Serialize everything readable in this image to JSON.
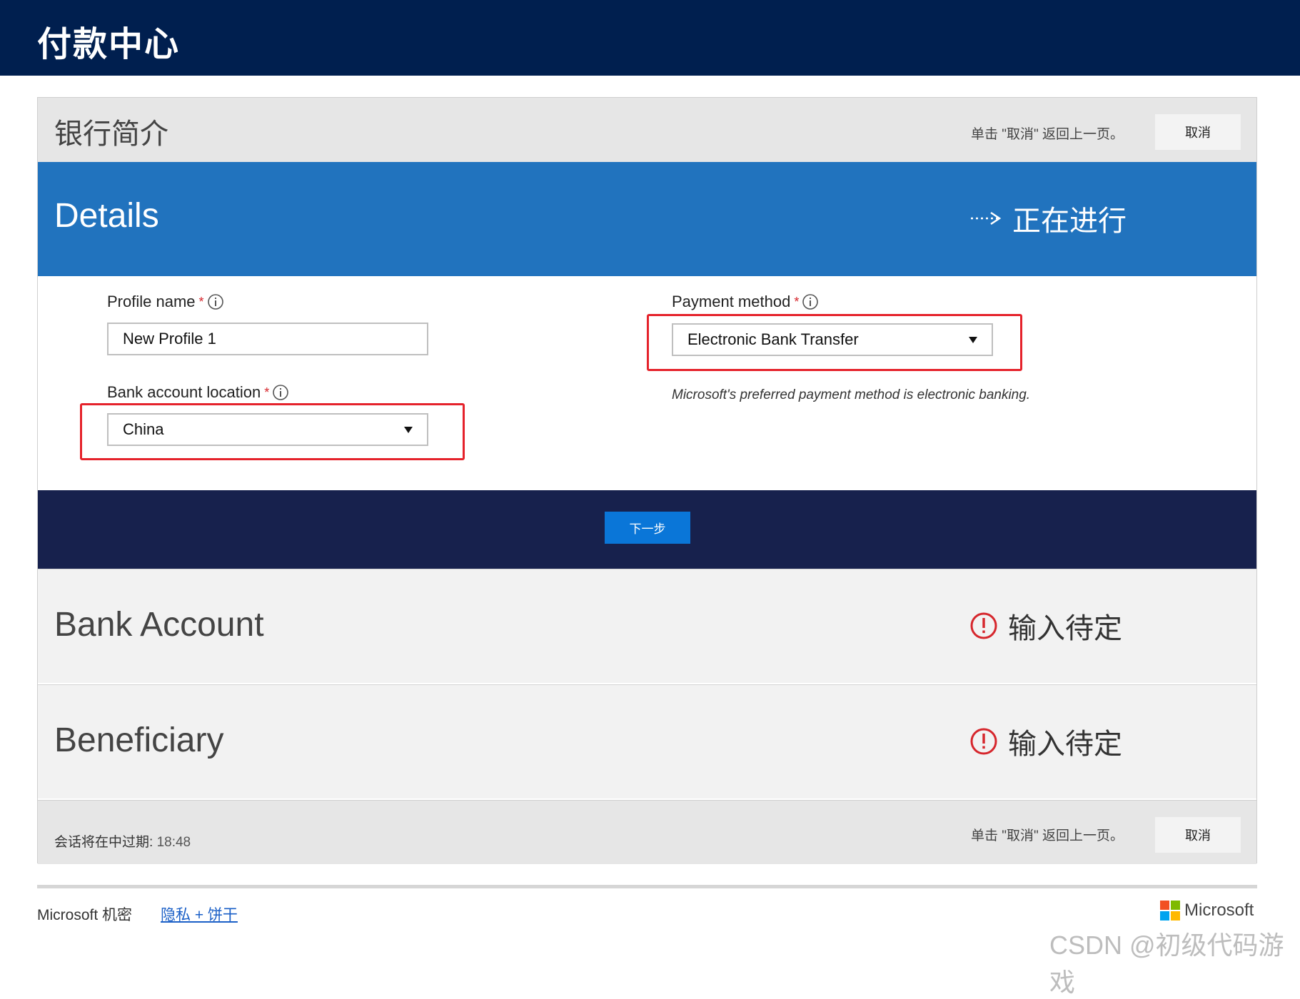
{
  "app": {
    "title": "付款中心"
  },
  "header": {
    "title": "银行简介",
    "hint": "单击 \"取消\" 返回上一页。",
    "cancel_label": "取消"
  },
  "sections": {
    "details": {
      "title": "Details",
      "status": "正在进行",
      "status_icon": "arrow-right-icon"
    },
    "bank_account": {
      "title": "Bank Account",
      "status": "输入待定",
      "status_icon": "alert-icon"
    },
    "beneficiary": {
      "title": "Beneficiary",
      "status": "输入待定",
      "status_icon": "alert-icon"
    }
  },
  "form": {
    "profile_name": {
      "label": "Profile name",
      "required": "*",
      "value": "New Profile 1"
    },
    "payment_method": {
      "label": "Payment method",
      "required": "*",
      "selected": "Electronic Bank Transfer"
    },
    "bank_location": {
      "label": "Bank account location",
      "required": "*",
      "selected": "China"
    },
    "payment_note": "Microsoft's preferred payment method is electronic banking."
  },
  "nav": {
    "next_label": "下一步"
  },
  "footer_bar": {
    "session_label": "会话将在中过期:",
    "session_time": "18:48",
    "hint": "单击 \"取消\" 返回上一页。",
    "cancel_label": "取消"
  },
  "page_footer": {
    "confidential": "Microsoft 机密",
    "privacy_link": "隐私 + 饼干",
    "brand": "Microsoft"
  },
  "watermark": "CSDN @初级代码游戏",
  "colors": {
    "top_bar": "#001f4f",
    "details_bar": "#2173be",
    "nav_bar": "#17214d",
    "next_button": "#0a76d8",
    "alert": "#d6262c",
    "highlight_box": "#e5222b"
  }
}
